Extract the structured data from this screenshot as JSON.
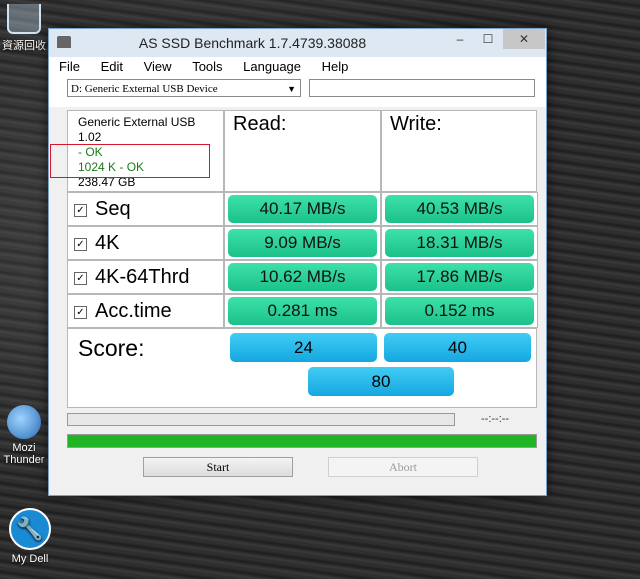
{
  "desktop": {
    "recycle_label": "資源回收",
    "thunder_label": "Mozi Thunder",
    "mydell_label": "My Dell"
  },
  "window": {
    "title": "AS SSD Benchmark 1.7.4739.38088",
    "controls": {
      "minimize": "–",
      "maximize": "☐",
      "close": "✕"
    }
  },
  "menu": [
    "File",
    "Edit",
    "View",
    "Tools",
    "Language",
    "Help"
  ],
  "drive_select": {
    "value": "D: Generic External USB Device"
  },
  "info": {
    "device": "Generic External USB",
    "firmware": "1.02",
    "driver_status": " - OK",
    "alignment": "1024 K - OK",
    "size": "238.47 GB"
  },
  "headers": {
    "read": "Read:",
    "write": "Write:"
  },
  "tests": [
    {
      "label": "Seq",
      "checked": true,
      "read": "40.17 MB/s",
      "write": "40.53 MB/s"
    },
    {
      "label": "4K",
      "checked": true,
      "read": "9.09 MB/s",
      "write": "18.31 MB/s"
    },
    {
      "label": "4K-64Thrd",
      "checked": true,
      "read": "10.62 MB/s",
      "write": "17.86 MB/s"
    },
    {
      "label": "Acc.time",
      "checked": true,
      "read": "0.281 ms",
      "write": "0.152 ms"
    }
  ],
  "score": {
    "title": "Score:",
    "read": "24",
    "write": "40",
    "total": "80"
  },
  "progress": {
    "time": "--:--:--",
    "overall_fraction": 1.0
  },
  "buttons": {
    "start": "Start",
    "abort": "Abort"
  },
  "colors": {
    "result_green": "#1cc08a",
    "score_blue": "#14a7e0",
    "progress_green": "#1fb526",
    "highlight_red": "#d8182a"
  }
}
